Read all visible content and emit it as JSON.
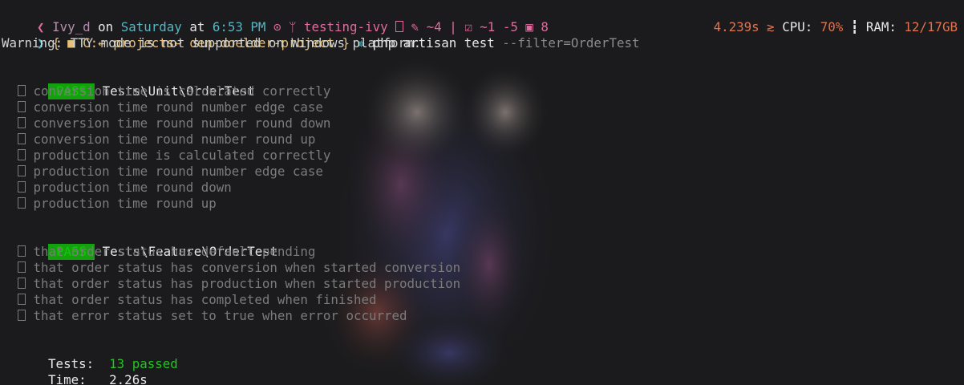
{
  "prompt": {
    "user": "Ivy_d",
    "on": "on",
    "day": "Saturday",
    "at": "at",
    "time": "6:53 PM",
    "git_branch": "testing-ivy",
    "git_modified": "~4",
    "git_staged_mod": "~1",
    "git_staged_del": "-5",
    "git_lock": "8",
    "separator": "|",
    "path_open": "{",
    "path_drive": "C:",
    "path_arrow1": "↩",
    "path_dir1": "projects",
    "path_arrow2": "↩",
    "path_dir2": "den-doelder-project",
    "path_close": "}",
    "command_main": "php artisan test",
    "command_arg": "--filter=OrderTest"
  },
  "status": {
    "duration": "4.239s",
    "cpu_label": "CPU:",
    "cpu_value": "70%",
    "ram_label": "RAM:",
    "ram_value": "12/17GB"
  },
  "warning": "Warning: TTY mode is not supported on Windows platform.",
  "suites": [
    {
      "badge": "PASS",
      "name": "Tests\\Unit\\OrderTest",
      "tests": [
        "conversion time is calculated correctly",
        "conversion time round number edge case",
        "conversion time round number round down",
        "conversion time round number round up",
        "production time is calculated correctly",
        "production time round number edge case",
        "production time round down",
        "production time round up"
      ]
    },
    {
      "badge": "PASS",
      "name": "Tests\\Feature\\OrderTest",
      "tests": [
        "that order status has default pending",
        "that order status has conversion when started conversion",
        "that order status has production when started production",
        "that order status has completed when finished",
        "that error status set to true when error occurred"
      ]
    }
  ],
  "summary": {
    "tests_label": "Tests:",
    "tests_value": "13 passed",
    "time_label": "Time:",
    "time_value": "2.26s"
  },
  "colors": {
    "background": "#1b1b1d",
    "pass_badge": "#13a10e",
    "passed_text": "#23c423",
    "stats": "#e0734f"
  }
}
